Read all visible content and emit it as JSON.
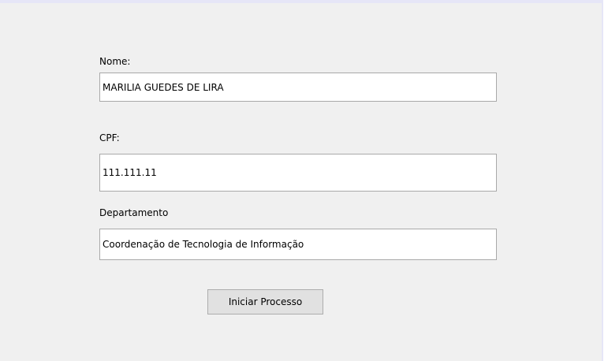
{
  "form": {
    "nome_label": "Nome:",
    "nome_value": "MARILIA GUEDES DE LIRA",
    "cpf_label": "CPF:",
    "cpf_value": "111.111.11",
    "departamento_label": "Departamento",
    "departamento_value": "Coordenação de Tecnologia de Informação",
    "submit_label": "Iniciar Processo"
  }
}
